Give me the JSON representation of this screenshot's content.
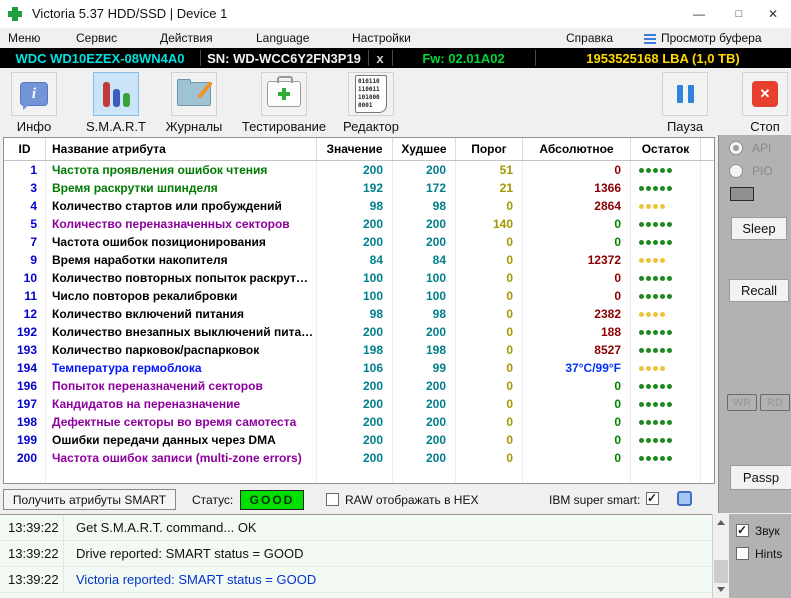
{
  "window": {
    "title": "Victoria 5.37 HDD/SSD | Device 1",
    "controls": {
      "minimize": "—",
      "maximize": "□",
      "close": "✕"
    }
  },
  "menu": {
    "items": [
      "Меню",
      "Сервис",
      "Действия",
      "Language",
      "Настройки",
      "Справка"
    ],
    "buffer_button": "Просмотр буфера"
  },
  "device_bar": {
    "model": "WDC WD10EZEX-08WN4A0",
    "serial": "SN: WD-WCC6Y2FN3P19",
    "close_label": "x",
    "firmware": "Fw: 02.01A02",
    "capacity": "1953525168 LBA (1,0 TB)"
  },
  "toolbar": {
    "info_label": "Инфо",
    "info_glyph": "i",
    "smart_label": "S.M.A.R.T",
    "journals_label": "Журналы",
    "testing_label": "Тестирование",
    "editor_label": "Редактор",
    "editor_lines": [
      "010110",
      "110011",
      "101000",
      "0001"
    ],
    "pause_label": "Пауза",
    "stop_label": "Стоп",
    "stop_glyph": "✕"
  },
  "smart_table": {
    "columns": [
      "ID",
      "Название атрибута",
      "Значение",
      "Худшее",
      "Порог",
      "Абсолютное",
      "Остаток"
    ],
    "rows": [
      {
        "id": "1",
        "name": "Частота проявления ошибок чтения",
        "name_color": "green",
        "value": "200",
        "worst": "200",
        "threshold": "51",
        "absolute": "0",
        "absolute_color": "maroon",
        "dots": 5,
        "dots_color": "green"
      },
      {
        "id": "3",
        "name": "Время раскрутки шпинделя",
        "name_color": "green",
        "value": "192",
        "worst": "172",
        "threshold": "21",
        "absolute": "1366",
        "absolute_color": "maroon",
        "dots": 5,
        "dots_color": "green"
      },
      {
        "id": "4",
        "name": "Количество стартов или пробуждений",
        "name_color": "black",
        "value": "98",
        "worst": "98",
        "threshold": "0",
        "absolute": "2864",
        "absolute_color": "maroon",
        "dots": 4,
        "dots_color": "yellow"
      },
      {
        "id": "5",
        "name": "Количество переназначенных секторов",
        "name_color": "purple",
        "value": "200",
        "worst": "200",
        "threshold": "140",
        "absolute": "0",
        "absolute_color": "green",
        "dots": 5,
        "dots_color": "green"
      },
      {
        "id": "7",
        "name": "Частота ошибок позиционирования",
        "name_color": "black",
        "value": "200",
        "worst": "200",
        "threshold": "0",
        "absolute": "0",
        "absolute_color": "green",
        "dots": 5,
        "dots_color": "green"
      },
      {
        "id": "9",
        "name": "Время наработки накопителя",
        "name_color": "black",
        "value": "84",
        "worst": "84",
        "threshold": "0",
        "absolute": "12372",
        "absolute_color": "maroon",
        "dots": 4,
        "dots_color": "yellow"
      },
      {
        "id": "10",
        "name": "Количество повторных попыток раскрут…",
        "name_color": "black",
        "value": "100",
        "worst": "100",
        "threshold": "0",
        "absolute": "0",
        "absolute_color": "maroon",
        "dots": 5,
        "dots_color": "green"
      },
      {
        "id": "11",
        "name": "Число повторов рекалибровки",
        "name_color": "black",
        "value": "100",
        "worst": "100",
        "threshold": "0",
        "absolute": "0",
        "absolute_color": "maroon",
        "dots": 5,
        "dots_color": "green"
      },
      {
        "id": "12",
        "name": "Количество включений питания",
        "name_color": "black",
        "value": "98",
        "worst": "98",
        "threshold": "0",
        "absolute": "2382",
        "absolute_color": "maroon",
        "dots": 4,
        "dots_color": "yellow"
      },
      {
        "id": "192",
        "name": "Количество внезапных выключений пита…",
        "name_color": "black",
        "value": "200",
        "worst": "200",
        "threshold": "0",
        "absolute": "188",
        "absolute_color": "maroon",
        "dots": 5,
        "dots_color": "green"
      },
      {
        "id": "193",
        "name": "Количество парковок/распарковок",
        "name_color": "black",
        "value": "198",
        "worst": "198",
        "threshold": "0",
        "absolute": "8527",
        "absolute_color": "maroon",
        "dots": 5,
        "dots_color": "green"
      },
      {
        "id": "194",
        "name": "Температура гермоблока",
        "name_color": "blue",
        "value": "106",
        "worst": "99",
        "threshold": "0",
        "absolute": "37°C/99°F",
        "absolute_color": "blue",
        "dots": 4,
        "dots_color": "yellow"
      },
      {
        "id": "196",
        "name": "Попыток переназначений секторов",
        "name_color": "purple",
        "value": "200",
        "worst": "200",
        "threshold": "0",
        "absolute": "0",
        "absolute_color": "green",
        "dots": 5,
        "dots_color": "green"
      },
      {
        "id": "197",
        "name": "Кандидатов на переназначение",
        "name_color": "purple",
        "value": "200",
        "worst": "200",
        "threshold": "0",
        "absolute": "0",
        "absolute_color": "green",
        "dots": 5,
        "dots_color": "green"
      },
      {
        "id": "198",
        "name": "Дефектные секторы во время самотеста",
        "name_color": "purple",
        "value": "200",
        "worst": "200",
        "threshold": "0",
        "absolute": "0",
        "absolute_color": "green",
        "dots": 5,
        "dots_color": "green"
      },
      {
        "id": "199",
        "name": "Ошибки передачи данных через DMA",
        "name_color": "black",
        "value": "200",
        "worst": "200",
        "threshold": "0",
        "absolute": "0",
        "absolute_color": "green",
        "dots": 5,
        "dots_color": "green"
      },
      {
        "id": "200",
        "name": "Частота ошибок записи (multi-zone errors)",
        "name_color": "purple",
        "value": "200",
        "worst": "200",
        "threshold": "0",
        "absolute": "0",
        "absolute_color": "green",
        "dots": 5,
        "dots_color": "green"
      }
    ]
  },
  "sidebar": {
    "api_label": "API",
    "pio_label": "PIO",
    "sleep_label": "Sleep",
    "recall_label": "Recall",
    "wr_label": "WR",
    "rd_label": "RD",
    "passp_label": "Passp"
  },
  "status_bar": {
    "get_smart_label": "Получить атрибуты SMART",
    "status_label": "Статус:",
    "status_value": "GOOD",
    "raw_hex_label": "RAW отображать в HEX",
    "raw_hex_checked": false,
    "ibm_label": "IBM super smart:",
    "ibm_checked": true
  },
  "log": {
    "entries": [
      {
        "time": "13:39:22",
        "message": "Get S.M.A.R.T. command... OK",
        "color": "black"
      },
      {
        "time": "13:39:22",
        "message": "Drive reported: SMART status = GOOD",
        "color": "black"
      },
      {
        "time": "13:39:22",
        "message": "Victoria reported: SMART status = GOOD",
        "color": "blue"
      }
    ],
    "sound_label": "Звук",
    "sound_checked": true,
    "hints_label": "Hints",
    "hints_checked": false
  },
  "colors": {
    "model_cyan": "#00e0e0",
    "firmware_green": "#00d535",
    "capacity_yellow": "#ffd900",
    "good_badge_green": "#00e000",
    "dot_green": "#1d8a1d",
    "dot_yellow": "#eec23c",
    "value_teal": "#007f8c",
    "threshold_olive": "#a39800",
    "absolute_maroon": "#8b0000",
    "absolute_green": "#008000"
  }
}
